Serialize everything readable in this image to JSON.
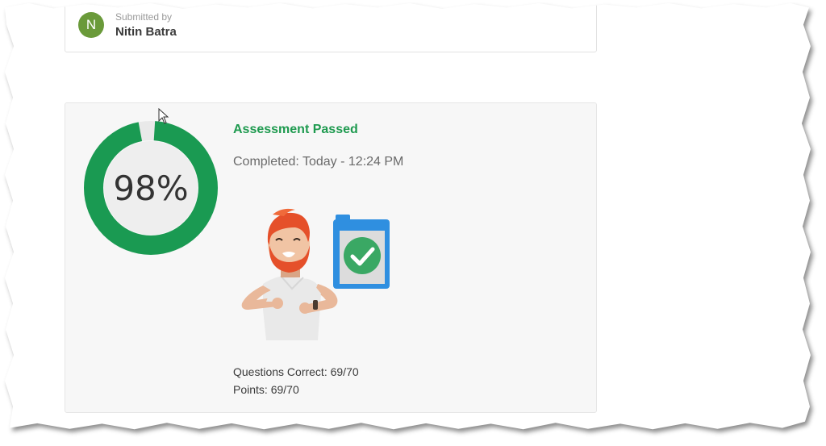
{
  "submitter": {
    "avatar_initial": "N",
    "label": "Submitted by",
    "name": "Nitin Batra"
  },
  "result": {
    "score_percent": 98,
    "score_label": "98%",
    "status": "Assessment Passed",
    "completed": "Completed: Today - 12:24 PM",
    "questions_correct_label": "Questions Correct:",
    "questions_correct_value": "69/70",
    "points_label": "Points:",
    "points_value": "69/70"
  },
  "colors": {
    "ring_green": "#1a9a52",
    "status_green": "#1e9a4f",
    "avatar_green": "#6a9a3a",
    "clipboard_blue": "#2f8fe0"
  },
  "icons": {
    "illustration": "person-with-checklist-illustration",
    "cursor": "mouse-pointer-icon"
  }
}
